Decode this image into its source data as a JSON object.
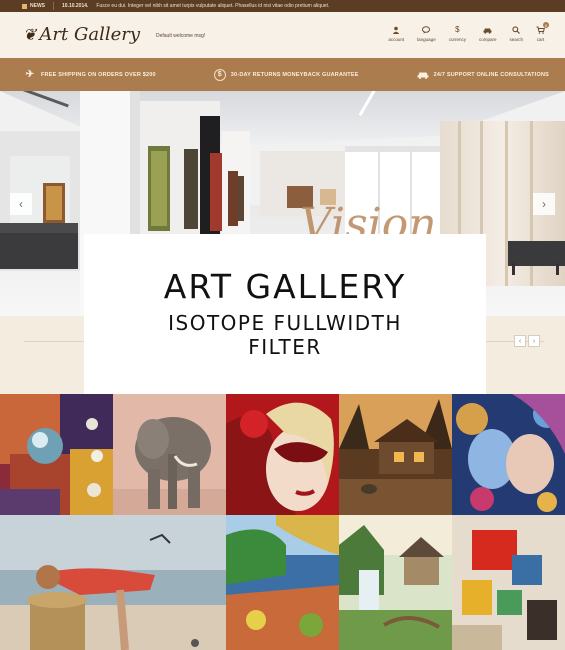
{
  "newsbar": {
    "label": "NEWS",
    "date": "10.10.2014.",
    "text": "Fusce eu dui. Integer vel nibh sit amet turpis vulputate aliquet. Phasellus id nisi vitae odio pretium aliquet."
  },
  "header": {
    "logo_text": "Art Gallery",
    "welcome": "Default welcome msg!",
    "nav": [
      {
        "label": "account",
        "icon": "user-icon"
      },
      {
        "label": "language",
        "icon": "chat-bubble-icon"
      },
      {
        "label": "currency",
        "icon": "dollar-icon"
      },
      {
        "label": "compare",
        "icon": "car-icon"
      },
      {
        "label": "search",
        "icon": "search-icon"
      },
      {
        "label": "cart",
        "icon": "cart-icon",
        "badge": "0"
      }
    ]
  },
  "promo": [
    {
      "text": "FREE SHIPPING ON ORDERS OVER $200",
      "icon": "plane-icon"
    },
    {
      "text": "30-DAY RETURNS MONEYBACK GUARANTEE",
      "icon": "dollar-circle-icon"
    },
    {
      "text": "24/7 SUPPORT ONLINE CONSULTATIONS",
      "icon": "car-icon"
    }
  ],
  "slider": {
    "prev_icon": "chevron-left-icon",
    "next_icon": "chevron-right-icon",
    "watermark": "Vision"
  },
  "title_card": {
    "title": "ART GALLERY",
    "subtitle_line1": "ISOTOPE FULLWIDTH",
    "subtitle_line2": "FILTER"
  },
  "colors": {
    "news_bg": "#5a3d23",
    "header_bg": "#f7f1e7",
    "promo_bg": "#ab7c4e",
    "page_bg": "#f3ece2"
  }
}
